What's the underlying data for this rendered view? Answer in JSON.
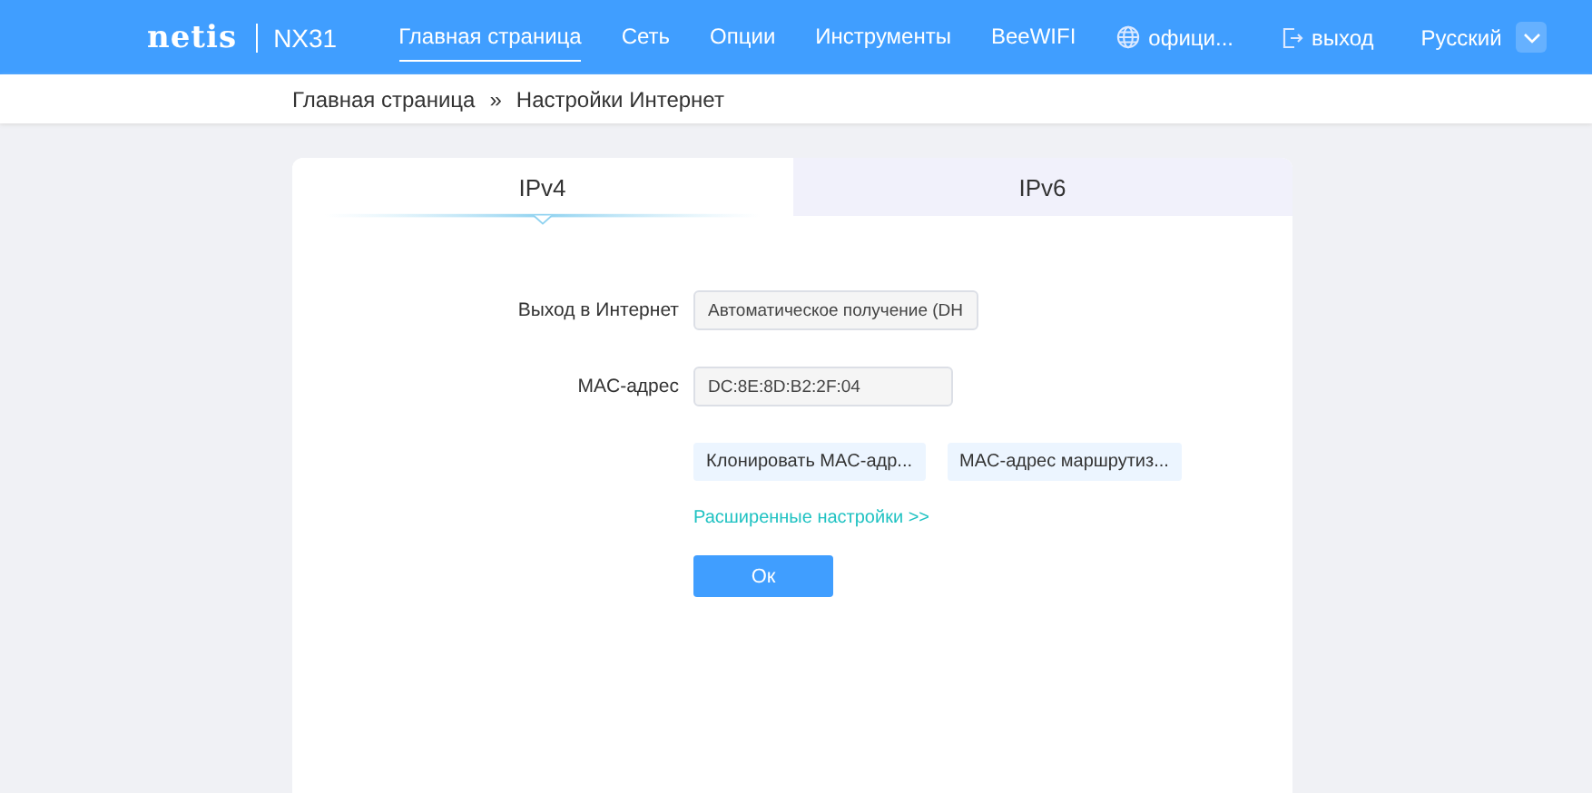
{
  "header": {
    "logo": "netis",
    "model": "NX31",
    "nav": [
      {
        "label": "Главная страница",
        "selected": true
      },
      {
        "label": "Сеть",
        "selected": false
      },
      {
        "label": "Опции",
        "selected": false
      },
      {
        "label": "Инструменты",
        "selected": false
      },
      {
        "label": "BeeWIFI",
        "selected": false
      }
    ],
    "official_link": "офици...",
    "logout": "выход",
    "language": "Русский"
  },
  "breadcrumb": [
    "Главная страница",
    "»",
    "Настройки Интернет"
  ],
  "tabs": [
    {
      "label": "IPv4",
      "selected": true
    },
    {
      "label": "IPv6",
      "selected": false
    }
  ],
  "form": {
    "fields": [
      {
        "label": "Выход в Интернет",
        "value": "Автоматическое получение (DH"
      },
      {
        "label": "MAC-адрес",
        "value": "DC:8E:8D:B2:2F:04"
      }
    ],
    "mac_buttons": [
      "Клонировать MAC-адр...",
      "MAC-адрес маршрутиз..."
    ],
    "advanced_link": "Расширенные настройки >>",
    "ok_button": "Ок"
  }
}
